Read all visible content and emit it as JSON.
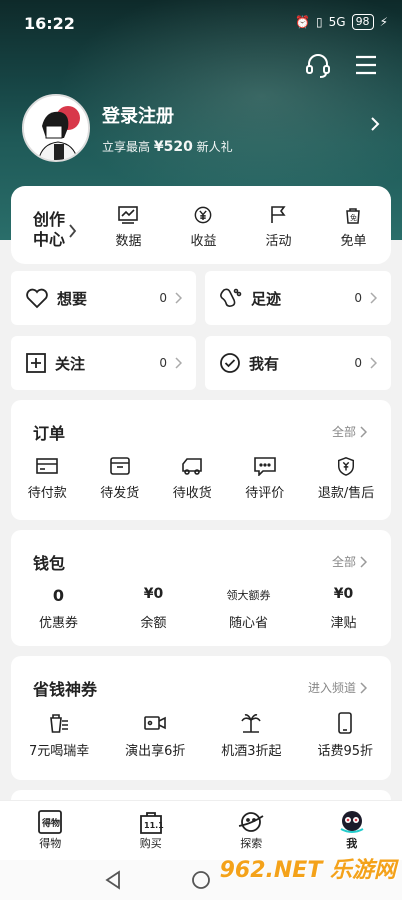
{
  "status": {
    "time": "16:22",
    "battery": "98",
    "net": "5G"
  },
  "profile": {
    "name": "登录注册",
    "sub_prefix": "立享最高",
    "sub_amount": "¥520",
    "sub_suffix": "新人礼"
  },
  "creator": {
    "label": "创作\n中心",
    "items": [
      {
        "label": "数据",
        "icon": "chart-icon"
      },
      {
        "label": "收益",
        "icon": "yen-coin-icon"
      },
      {
        "label": "活动",
        "icon": "flag-icon"
      },
      {
        "label": "免单",
        "icon": "bag-icon"
      }
    ]
  },
  "quick": {
    "want": {
      "label": "想要",
      "count": "0"
    },
    "footprint": {
      "label": "足迹",
      "count": "0"
    },
    "follow": {
      "label": "关注",
      "count": "0"
    },
    "own": {
      "label": "我有",
      "count": "0"
    }
  },
  "orders": {
    "title": "订单",
    "link": "全部",
    "items": [
      {
        "label": "待付款"
      },
      {
        "label": "待发货"
      },
      {
        "label": "待收货"
      },
      {
        "label": "待评价"
      },
      {
        "label": "退款/售后"
      }
    ]
  },
  "wallet": {
    "title": "钱包",
    "link": "全部",
    "items": [
      {
        "value": "0",
        "label": "优惠券"
      },
      {
        "value": "¥0",
        "label": "余额"
      },
      {
        "value": "领大额券",
        "label": "随心省"
      },
      {
        "value": "¥0",
        "label": "津贴"
      }
    ]
  },
  "coupons": {
    "title": "省钱神券",
    "link": "进入频道",
    "items": [
      {
        "label": "7元喝瑞幸"
      },
      {
        "label": "演出享6折"
      },
      {
        "label": "机酒3折起"
      },
      {
        "label": "话费95折"
      }
    ]
  },
  "tabs": [
    {
      "label": "得物"
    },
    {
      "label": "购买"
    },
    {
      "label": "探索"
    },
    {
      "label": "我"
    }
  ],
  "watermark": "962.NET 乐游网"
}
